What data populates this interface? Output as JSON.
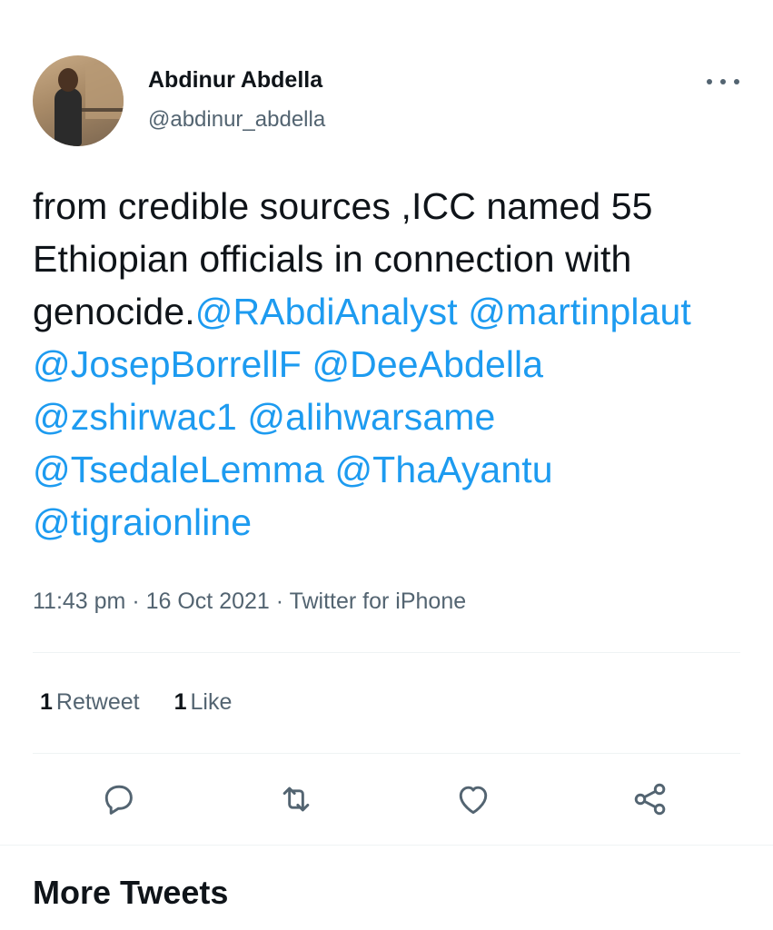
{
  "author": {
    "display_name": "Abdinur Abdella",
    "handle": "@abdinur_abdella"
  },
  "tweet": {
    "segments": [
      {
        "text": "from credible sources ,ICC named 55 Ethiopian officials in connection with genocide.",
        "type": "text"
      },
      {
        "text": "@RAbdiAnalyst",
        "type": "mention"
      },
      {
        "text": " ",
        "type": "text"
      },
      {
        "text": "@martinplaut",
        "type": "mention"
      },
      {
        "text": " ",
        "type": "text"
      },
      {
        "text": "@JosepBorrellF",
        "type": "mention"
      },
      {
        "text": " ",
        "type": "text"
      },
      {
        "text": "@DeeAbdella",
        "type": "mention"
      },
      {
        "text": " ",
        "type": "text"
      },
      {
        "text": "@zshirwac1",
        "type": "mention"
      },
      {
        "text": " ",
        "type": "text"
      },
      {
        "text": "@alihwarsame",
        "type": "mention"
      },
      {
        "text": " ",
        "type": "text"
      },
      {
        "text": "@TsedaleLemma",
        "type": "mention"
      },
      {
        "text": " ",
        "type": "text"
      },
      {
        "text": "@ThaAyantu",
        "type": "mention"
      },
      {
        "text": " ",
        "type": "text"
      },
      {
        "text": "@tigraionline",
        "type": "mention"
      }
    ]
  },
  "meta": {
    "time": "11:43 pm",
    "separator1": " · ",
    "date": "16 Oct 2021",
    "separator2": " · ",
    "source": "Twitter for iPhone"
  },
  "stats": {
    "retweets_count": "1",
    "retweets_label": "Retweet",
    "likes_count": "1",
    "likes_label": "Like"
  },
  "actions": {
    "reply_icon": "reply-icon",
    "retweet_icon": "retweet-icon",
    "like_icon": "heart-icon",
    "share_icon": "share-icon"
  },
  "section": {
    "more_tweets": "More Tweets"
  },
  "colors": {
    "accent": "#1d9bf0",
    "text": "#0f1419",
    "secondary": "#536471",
    "divider": "#eff3f4"
  }
}
